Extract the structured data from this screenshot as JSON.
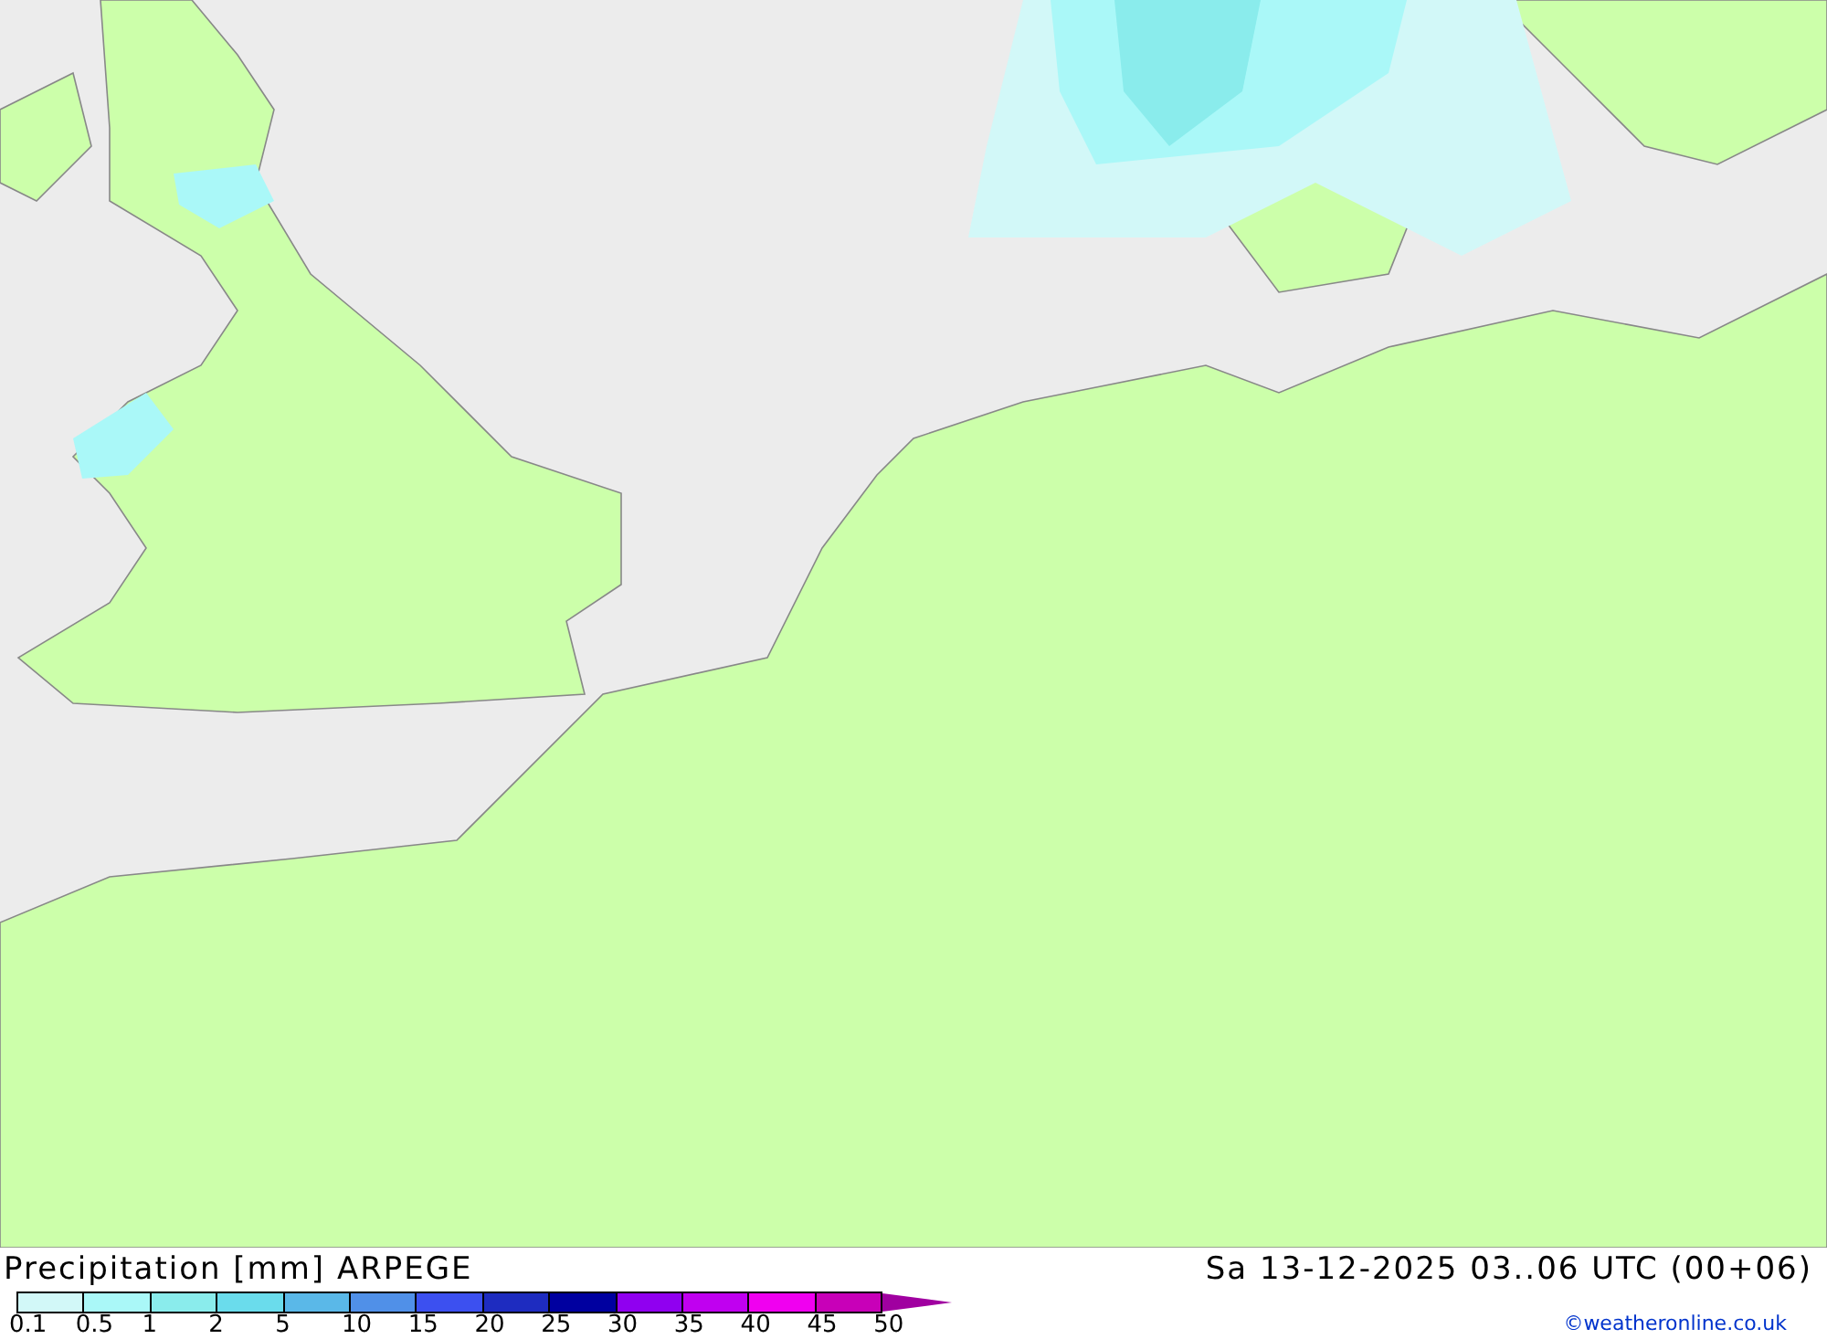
{
  "title": "Precipitation [mm] ARPEGE",
  "valid_time": "Sa 13-12-2025 03..06 UTC (00+06)",
  "legend": {
    "colors": [
      {
        "color": "#d2f8f8"
      },
      {
        "color": "#aaf8f8"
      },
      {
        "color": "#8aecec"
      },
      {
        "color": "#6adcec"
      },
      {
        "color": "#5ab8e8"
      },
      {
        "color": "#5090e8"
      },
      {
        "color": "#3c50f0"
      },
      {
        "color": "#1e2cc0"
      },
      {
        "color": "#0000a0"
      },
      {
        "color": "#9000f0"
      },
      {
        "color": "#c000f0"
      },
      {
        "color": "#f000f0"
      },
      {
        "color": "#c800b8"
      }
    ],
    "labels": [
      "0.1",
      "0.5",
      "1",
      "2",
      "5",
      "10",
      "15",
      "20",
      "25",
      "30",
      "35",
      "40",
      "45",
      "50"
    ]
  },
  "credit": "©weatheronline.co.uk"
}
